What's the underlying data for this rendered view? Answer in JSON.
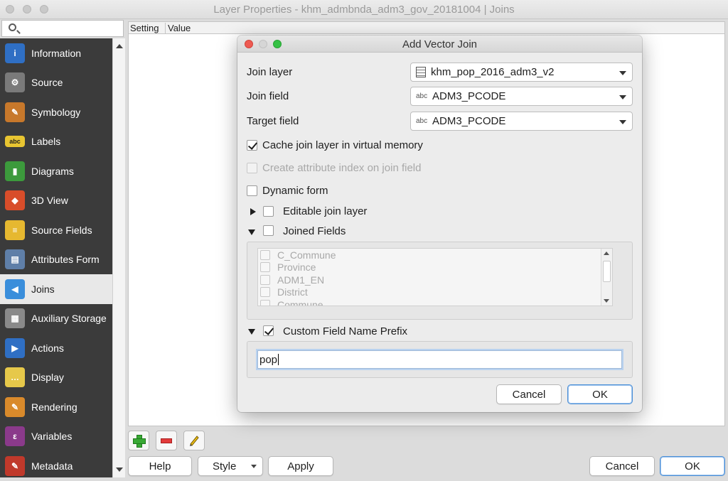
{
  "window": {
    "title": "Layer Properties - khm_admbnda_adm3_gov_20181004 | Joins"
  },
  "sidebar": {
    "items": [
      {
        "label": "Information",
        "icon": "info-icon",
        "color": "#2f6fc4",
        "glyph": "i"
      },
      {
        "label": "Source",
        "icon": "source-tools-icon",
        "color": "#7a7a7a",
        "glyph": "⚙"
      },
      {
        "label": "Symbology",
        "icon": "paint-brush-icon",
        "color": "#c7782b",
        "glyph": "✎"
      },
      {
        "label": "Labels",
        "icon": "abc-label-icon",
        "color": "#e8c531",
        "glyph": "abc"
      },
      {
        "label": "Diagrams",
        "icon": "diagram-chart-icon",
        "color": "#3c9a3c",
        "glyph": "▮"
      },
      {
        "label": "3D View",
        "icon": "cube-3d-icon",
        "color": "#d84d2a",
        "glyph": "◆"
      },
      {
        "label": "Source Fields",
        "icon": "source-fields-icon",
        "color": "#e6b830",
        "glyph": "≡"
      },
      {
        "label": "Attributes Form",
        "icon": "attributes-form-icon",
        "color": "#5f7fa8",
        "glyph": "▤"
      },
      {
        "label": "Joins",
        "icon": "joins-icon",
        "color": "#3a8edb",
        "glyph": "◀"
      },
      {
        "label": "Auxiliary Storage",
        "icon": "database-icon",
        "color": "#8a8a8a",
        "glyph": "▦"
      },
      {
        "label": "Actions",
        "icon": "actions-gear-icon",
        "color": "#2f6fc4",
        "glyph": "▶"
      },
      {
        "label": "Display",
        "icon": "speech-bubble-icon",
        "color": "#e6c84a",
        "glyph": "…"
      },
      {
        "label": "Rendering",
        "icon": "rendering-brush-icon",
        "color": "#d98a2b",
        "glyph": "✎"
      },
      {
        "label": "Variables",
        "icon": "epsilon-icon",
        "color": "#8b3a8b",
        "glyph": "ε"
      },
      {
        "label": "Metadata",
        "icon": "metadata-icon",
        "color": "#c0392b",
        "glyph": "✎"
      }
    ],
    "active_index": 8
  },
  "table": {
    "columns": [
      "Setting",
      "Value"
    ]
  },
  "bottom": {
    "help": "Help",
    "style": "Style",
    "apply": "Apply",
    "cancel": "Cancel",
    "ok": "OK"
  },
  "dialog": {
    "title": "Add Vector Join",
    "join_layer_label": "Join layer",
    "join_layer_value": "khm_pop_2016_adm3_v2",
    "join_field_label": "Join field",
    "join_field_value": "ADM3_PCODE",
    "target_field_label": "Target field",
    "target_field_value": "ADM3_PCODE",
    "abc_tag": "abc",
    "cache_label": "Cache join layer in virtual memory",
    "cache_checked": true,
    "index_label": "Create attribute index on join field",
    "dynamic_label": "Dynamic form",
    "editable_label": "Editable join layer",
    "joined_fields_label": "Joined Fields",
    "fields": [
      "C_Commune",
      "Province",
      "ADM1_EN",
      "District",
      "Commune"
    ],
    "prefix_label": "Custom Field Name Prefix",
    "prefix_value": "pop",
    "cancel": "Cancel",
    "ok": "OK"
  }
}
